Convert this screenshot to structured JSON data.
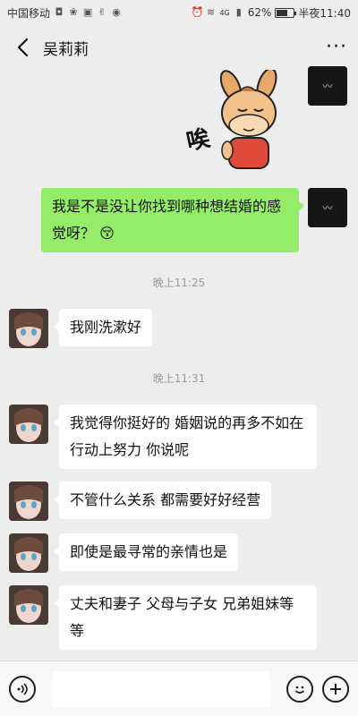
{
  "status_bar": {
    "carrier": "中国移动",
    "network": "4G",
    "battery": "62%",
    "battery_level": 0.62,
    "time": "半夜11:40"
  },
  "nav": {
    "title": "吴莉莉",
    "more": "···"
  },
  "sticker": {
    "caption": "唉"
  },
  "messages": {
    "m1": "我是不是没让你找到哪种想结婚的感觉呀？",
    "m1_emoji": "😚",
    "t1": "晚上11:25",
    "m2": "我刚洗漱好",
    "t2": "晚上11:31",
    "m3": "我觉得你挺好的 婚姻说的再多不如在行动上努力 你说呢",
    "m4": "不管什么关系 都需要好好经营",
    "m5": "即使是最寻常的亲情也是",
    "m6": "丈夫和妻子 父母与子女 兄弟姐妹等等"
  },
  "colors": {
    "self_bubble": "#95ec69",
    "other_bubble": "#ffffff",
    "background": "#ededed"
  }
}
